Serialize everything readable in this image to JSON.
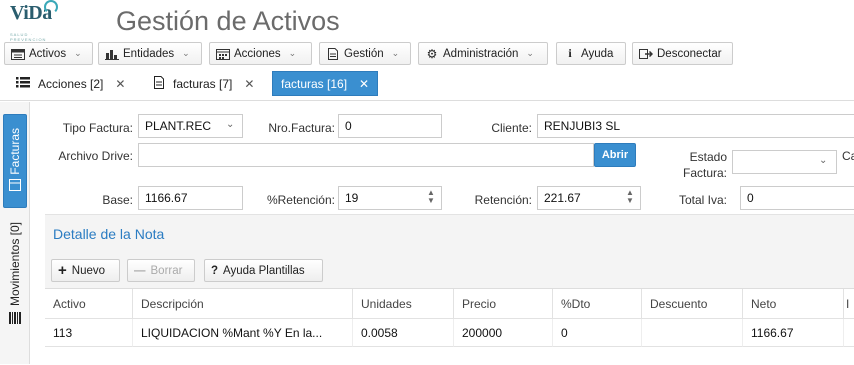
{
  "header": {
    "logo_text": "ViDa",
    "logo_sub": "SALUD · PREVENCION",
    "app_title": "Gestión de Activos"
  },
  "menubar": {
    "items": [
      {
        "label": "Activos",
        "icon": "list-window-icon"
      },
      {
        "label": "Entidades",
        "icon": "bar-chart-icon"
      },
      {
        "label": "Acciones",
        "icon": "calendar-icon"
      },
      {
        "label": "Gestión",
        "icon": "document-icon"
      },
      {
        "label": "Administración",
        "icon": "gears-icon"
      },
      {
        "label": "Ayuda",
        "icon": "info-icon"
      },
      {
        "label": "Desconectar",
        "icon": "logout-icon"
      }
    ]
  },
  "tabs": [
    {
      "label": "Acciones [2]",
      "icon": "list-icon"
    },
    {
      "label": "facturas [7]",
      "icon": "document-icon"
    },
    {
      "label": "facturas [16]",
      "active": true
    }
  ],
  "side_tabs": {
    "facturas": "Facturas",
    "movimientos": "Movimientos [0]"
  },
  "form": {
    "tipo_factura_label": "Tipo Factura:",
    "tipo_factura_value": "PLANT.REC",
    "nro_factura_label": "Nro.Factura:",
    "nro_factura_value": "0",
    "cliente_label": "Cliente:",
    "cliente_value": "RENJUBI3 SL",
    "archivo_drive_label": "Archivo Drive:",
    "archivo_drive_value": "",
    "abrir_label": "Abrir",
    "estado_factura_label_1": "Estado",
    "estado_factura_label_2": "Factura:",
    "estado_factura_value": "",
    "cut_label": "Ca",
    "base_label": "Base:",
    "base_value": "1166.67",
    "retencion_pct_label": "%Retención:",
    "retencion_pct_value": "19",
    "retencion_label": "Retención:",
    "retencion_value": "221.67",
    "total_iva_label": "Total Iva:",
    "total_iva_value": "0"
  },
  "detalle": {
    "title": "Detalle de la Nota",
    "nuevo_label": "Nuevo",
    "borrar_label": "Borrar",
    "ayuda_label": "Ayuda Plantillas",
    "columns": [
      "Activo",
      "Descripción",
      "Unidades",
      "Precio",
      "%Dto",
      "Descuento",
      "Neto",
      "I"
    ],
    "rows": [
      [
        "113",
        "LIQUIDACION %Mant %Y En la...",
        "0.0058",
        "200000",
        "0",
        "",
        "1166.67",
        ""
      ]
    ]
  },
  "colors": {
    "accent": "#3a8fd0",
    "title_gray": "#6b6b6b",
    "section_blue": "#2a7cc2"
  }
}
